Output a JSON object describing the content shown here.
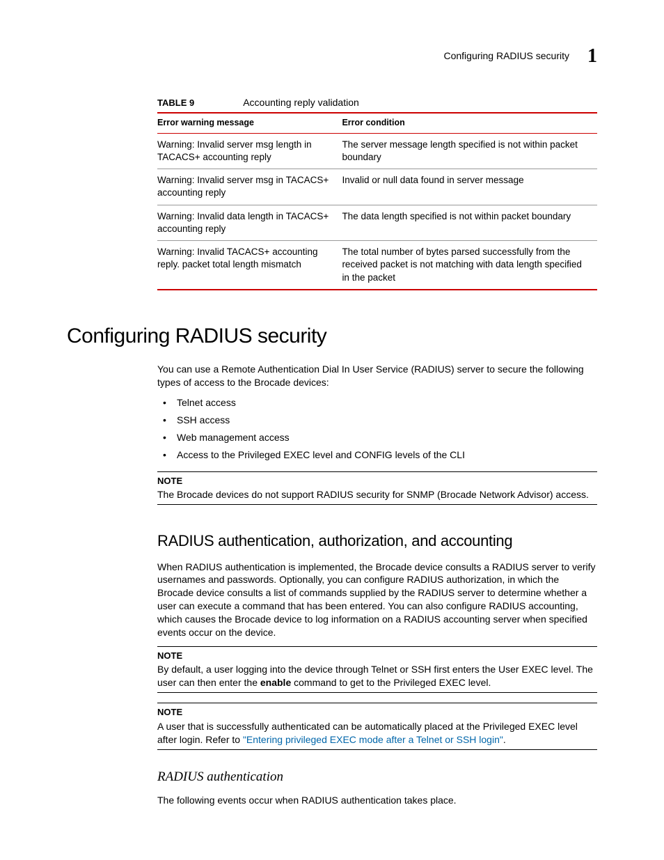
{
  "running_header": {
    "text": "Configuring RADIUS security",
    "chapter_number": "1"
  },
  "table": {
    "label": "TABLE 9",
    "caption": "Accounting reply validation",
    "headers": {
      "col1": "Error warning message",
      "col2": "Error condition"
    },
    "rows": [
      {
        "msg": "Warning: Invalid server msg length in TACACS+ accounting reply",
        "cond": "The server message length specified is not within packet boundary"
      },
      {
        "msg": "Warning: Invalid server msg in TACACS+ accounting reply",
        "cond": "Invalid or null data found in server message"
      },
      {
        "msg": "Warning: Invalid data length in TACACS+ accounting reply",
        "cond": "The data length specified is not within packet boundary"
      },
      {
        "msg": "Warning: Invalid TACACS+ accounting reply. packet total length mismatch",
        "cond": "The total number of bytes parsed successfully from the received packet is not matching with data length specified in the packet"
      }
    ]
  },
  "section": {
    "h1": "Configuring RADIUS security",
    "intro": "You can use a Remote Authentication Dial In User Service (RADIUS) server to secure the following types of access to the Brocade devices:",
    "bullets": [
      "Telnet access",
      "SSH access",
      "Web management access",
      "Access to the Privileged EXEC level and CONFIG levels of the CLI"
    ],
    "note1": {
      "label": "NOTE",
      "body": "The Brocade devices do not support RADIUS security for SNMP (Brocade Network Advisor) access."
    },
    "h2": "RADIUS authentication, authorization, and accounting",
    "para2": "When RADIUS authentication is implemented, the Brocade device consults a RADIUS server to verify usernames and passwords. Optionally, you can configure RADIUS authorization, in which the Brocade device consults a list of commands supplied by the RADIUS server to determine whether a user can execute a command that has been entered. You can also configure RADIUS accounting, which causes the Brocade device to log information on a RADIUS accounting server when specified events occur on the device.",
    "note2": {
      "label": "NOTE",
      "body_pre": "By default, a user logging into the device through Telnet or SSH first enters the User EXEC level. The user can then enter the ",
      "body_bold": "enable",
      "body_post": " command to get to the Privileged EXEC level."
    },
    "note3": {
      "label": "NOTE",
      "body_pre": "A user that is successfully authenticated can be automatically placed at the Privileged EXEC level after login. Refer to ",
      "link": "\"Entering privileged EXEC mode after a Telnet or SSH login\"",
      "body_post": "."
    },
    "h3": "RADIUS authentication",
    "para3": "The following events occur when RADIUS authentication takes place."
  }
}
